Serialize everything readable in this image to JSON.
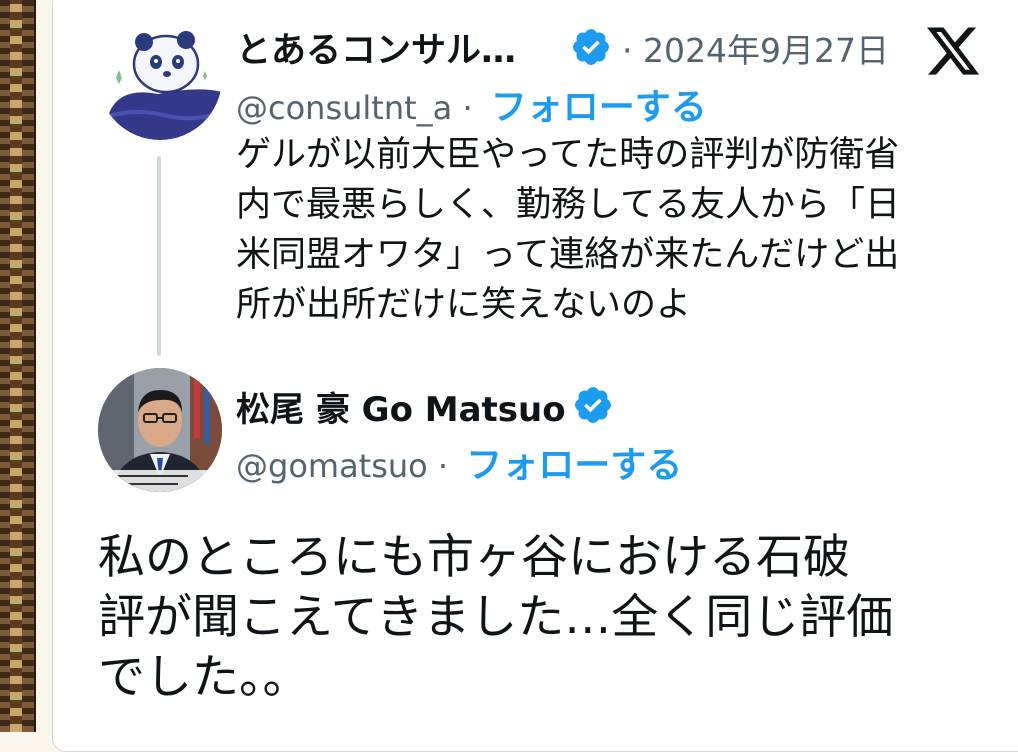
{
  "quoted_tweet": {
    "display_name": "とあるコンサル…",
    "date_separator": "·",
    "date": "2024年9月27日",
    "handle": "@consultnt_a",
    "handle_separator": "·",
    "follow_label": "フォローする",
    "text_lines": [
      "ゲルが以前大臣やってた時の評判が防衛省",
      "内で最悪らしく、勤務してる友人から「日",
      "米同盟オワタ」って連絡が来たんだけど出",
      "所が出所だけに笑えないのよ"
    ]
  },
  "main_tweet": {
    "display_name": "松尾 豪 Go Matsuo",
    "handle": "@gomatsuo",
    "handle_separator": "·",
    "follow_label": "フォローする",
    "text_lines": [
      "私のところにも市ヶ谷における石破",
      "評が聞こえてきました…全く同じ評価",
      "でした。。"
    ]
  },
  "colors": {
    "accent": "#1d9bf0",
    "text": "#0f1419",
    "muted": "#536471"
  },
  "icons": [
    "x-logo-icon",
    "verified-badge-icon"
  ]
}
